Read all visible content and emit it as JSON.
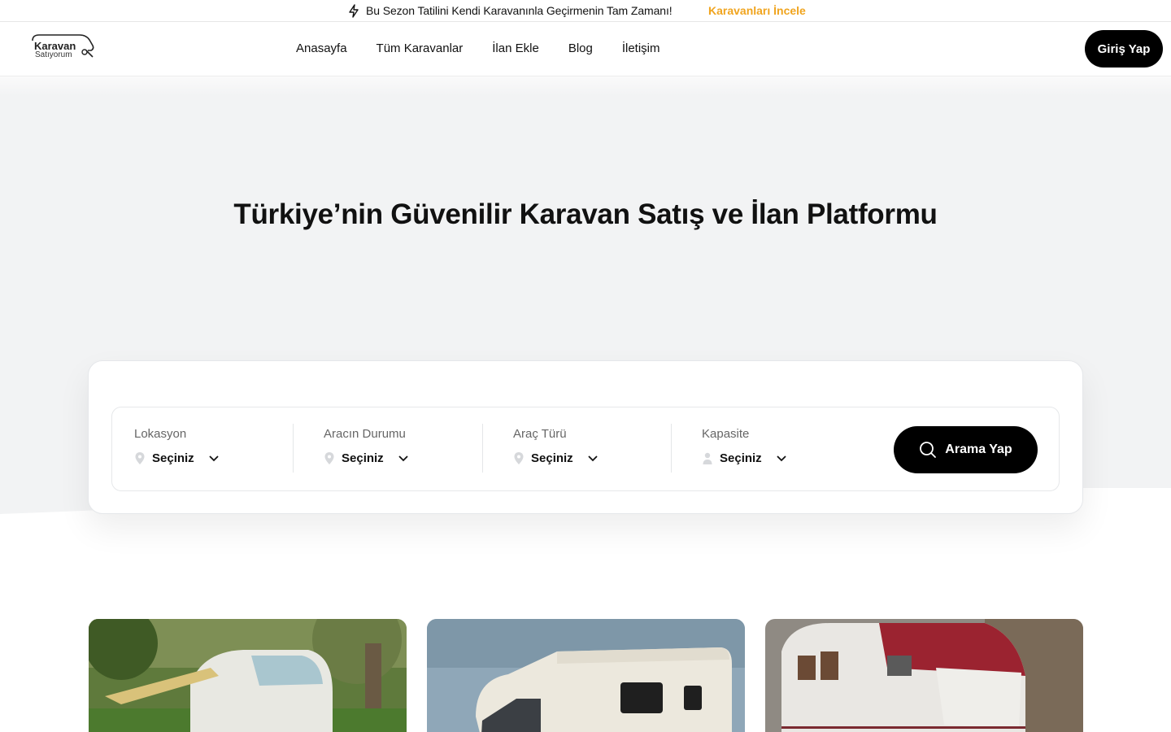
{
  "announcement": {
    "message": "Bu Sezon Tatilini Kendi Karavanınla Geçirmenin Tam Zamanı!",
    "link_label": "Karavanları İncele",
    "link_color": "#f0a41e",
    "icon": "bolt-icon"
  },
  "header": {
    "logo": {
      "line1": "Karavan",
      "line2": "Satıyorum"
    },
    "nav": [
      "Anasayfa",
      "Tüm Karavanlar",
      "İlan Ekle",
      "Blog",
      "İletişim"
    ],
    "login_label": "Giriş Yap"
  },
  "hero": {
    "title": "Türkiye’nin Güvenilir Karavan Satış ve İlan Platformu"
  },
  "search": {
    "fields": [
      {
        "label": "Lokasyon",
        "value": "Seçiniz",
        "icon": "location-pin-icon"
      },
      {
        "label": "Aracın Durumu",
        "value": "Seçiniz",
        "icon": "location-pin-icon"
      },
      {
        "label": "Araç Türü",
        "value": "Seçiniz",
        "icon": "location-pin-icon"
      },
      {
        "label": "Kapasite",
        "value": "Seçiniz",
        "icon": "user-icon"
      }
    ],
    "button_label": "Arama Yap"
  },
  "listings": [
    {
      "image": "caravan-forest-photo"
    },
    {
      "image": "motorhome-sky-photo"
    },
    {
      "image": "vintage-caravan-red-photo"
    }
  ]
}
